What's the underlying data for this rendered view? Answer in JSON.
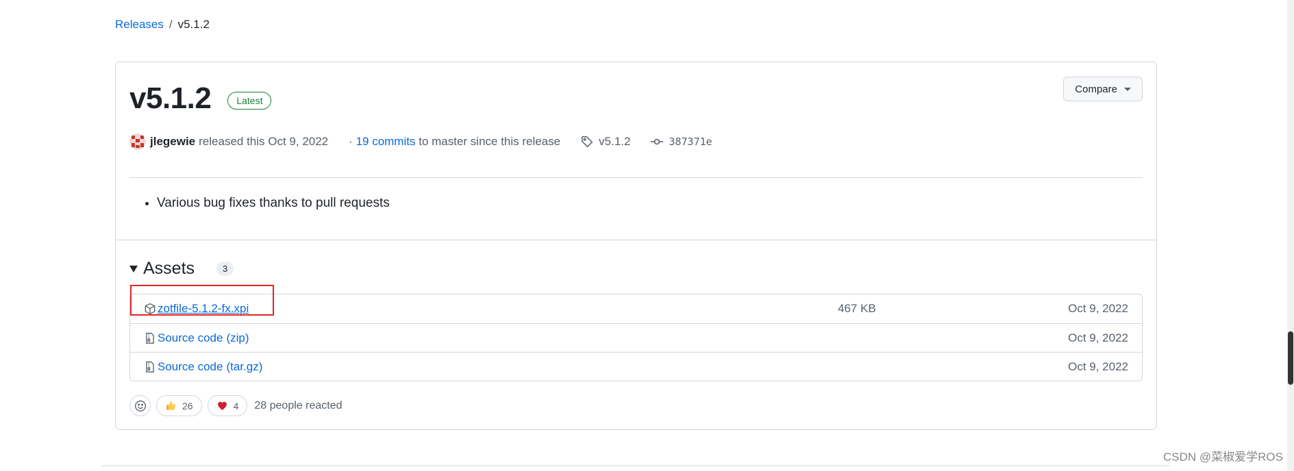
{
  "breadcrumb": {
    "releases": "Releases",
    "separator": "/",
    "current": "v5.1.2"
  },
  "release": {
    "title": "v5.1.2",
    "badge": "Latest",
    "compare_label": "Compare",
    "author": "jlegewie",
    "released_text": "released this Oct 9, 2022",
    "commits_prefix": "·",
    "commits_link": "19 commits",
    "commits_suffix": "to master since this release",
    "tag": "v5.1.2",
    "commit_sha": "387371e",
    "notes": [
      "Various bug fixes thanks to pull requests"
    ]
  },
  "assets": {
    "title": "Assets",
    "count": "3",
    "items": [
      {
        "name": "zotfile-5.1.2-fx.xpi",
        "suffix": "",
        "size": "467 KB",
        "date": "Oct 9, 2022",
        "icon": "package-icon"
      },
      {
        "name": "Source code",
        "suffix": "(zip)",
        "size": "",
        "date": "Oct 9, 2022",
        "icon": "file-zip-icon"
      },
      {
        "name": "Source code",
        "suffix": "(tar.gz)",
        "size": "",
        "date": "Oct 9, 2022",
        "icon": "file-zip-icon"
      }
    ]
  },
  "reactions": {
    "thumbs_up": "26",
    "heart": "4",
    "summary": "28 people reacted"
  },
  "watermark": "CSDN @菜椒爱学ROS",
  "colors": {
    "link": "#0969da",
    "latest": "#1a7f37",
    "highlight": "#e02424",
    "heart": "#cf222e"
  }
}
